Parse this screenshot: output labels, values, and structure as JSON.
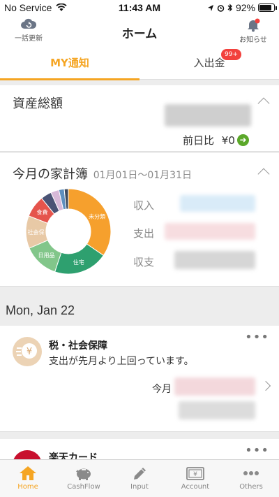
{
  "status_bar": {
    "carrier": "No Service",
    "time": "11:43 AM",
    "battery": "92%",
    "battery_level": 0.92
  },
  "header": {
    "title": "ホーム",
    "left_button_label": "一括更新",
    "right_button_label": "お知らせ"
  },
  "tabs": [
    {
      "label": "MY通知",
      "active": true
    },
    {
      "label": "入出金",
      "badge": "99+"
    }
  ],
  "assets_card": {
    "title": "資産総額",
    "compare_label": "前日比",
    "compare_value": "¥0"
  },
  "household_card": {
    "title": "今月の家計簿",
    "date_range": "01月01日〜01月31日",
    "rows": [
      {
        "label": "収入"
      },
      {
        "label": "支出"
      },
      {
        "label": "収支"
      }
    ],
    "chart_data": {
      "type": "pie",
      "categories": [
        "未分類",
        "住宅",
        "日用品",
        "社会保",
        "食費",
        "",
        "",
        "",
        ""
      ],
      "values": [
        33.5,
        20,
        13,
        12,
        8,
        4,
        3,
        2,
        1.5
      ],
      "colors": [
        "#f6a02d",
        "#2ea06f",
        "#82c68a",
        "#e8c9a6",
        "#e5544c",
        "#4a5375",
        "#d7b9d8",
        "#5e8fbe",
        "#3f4b5e"
      ]
    }
  },
  "feed": {
    "date_heading": "Mon, Jan 22",
    "items": [
      {
        "title": "税・社会保障",
        "message": "支出が先月より上回っています。",
        "compare_label": "今月",
        "icon": "yen-coin-icon"
      },
      {
        "title": "楽天カード",
        "icon": "card-logo-icon"
      }
    ]
  },
  "bottom_nav": [
    {
      "label": "Home",
      "icon": "home-icon",
      "active": true
    },
    {
      "label": "CashFlow",
      "icon": "piggy-bank-icon"
    },
    {
      "label": "Input",
      "icon": "pencil-icon"
    },
    {
      "label": "Account",
      "icon": "wallet-icon"
    },
    {
      "label": "Others",
      "icon": "more-icon"
    }
  ],
  "colors": {
    "accent": "#f5a523",
    "badge": "#f2413d",
    "positive_arrow": "#5ba82a"
  }
}
